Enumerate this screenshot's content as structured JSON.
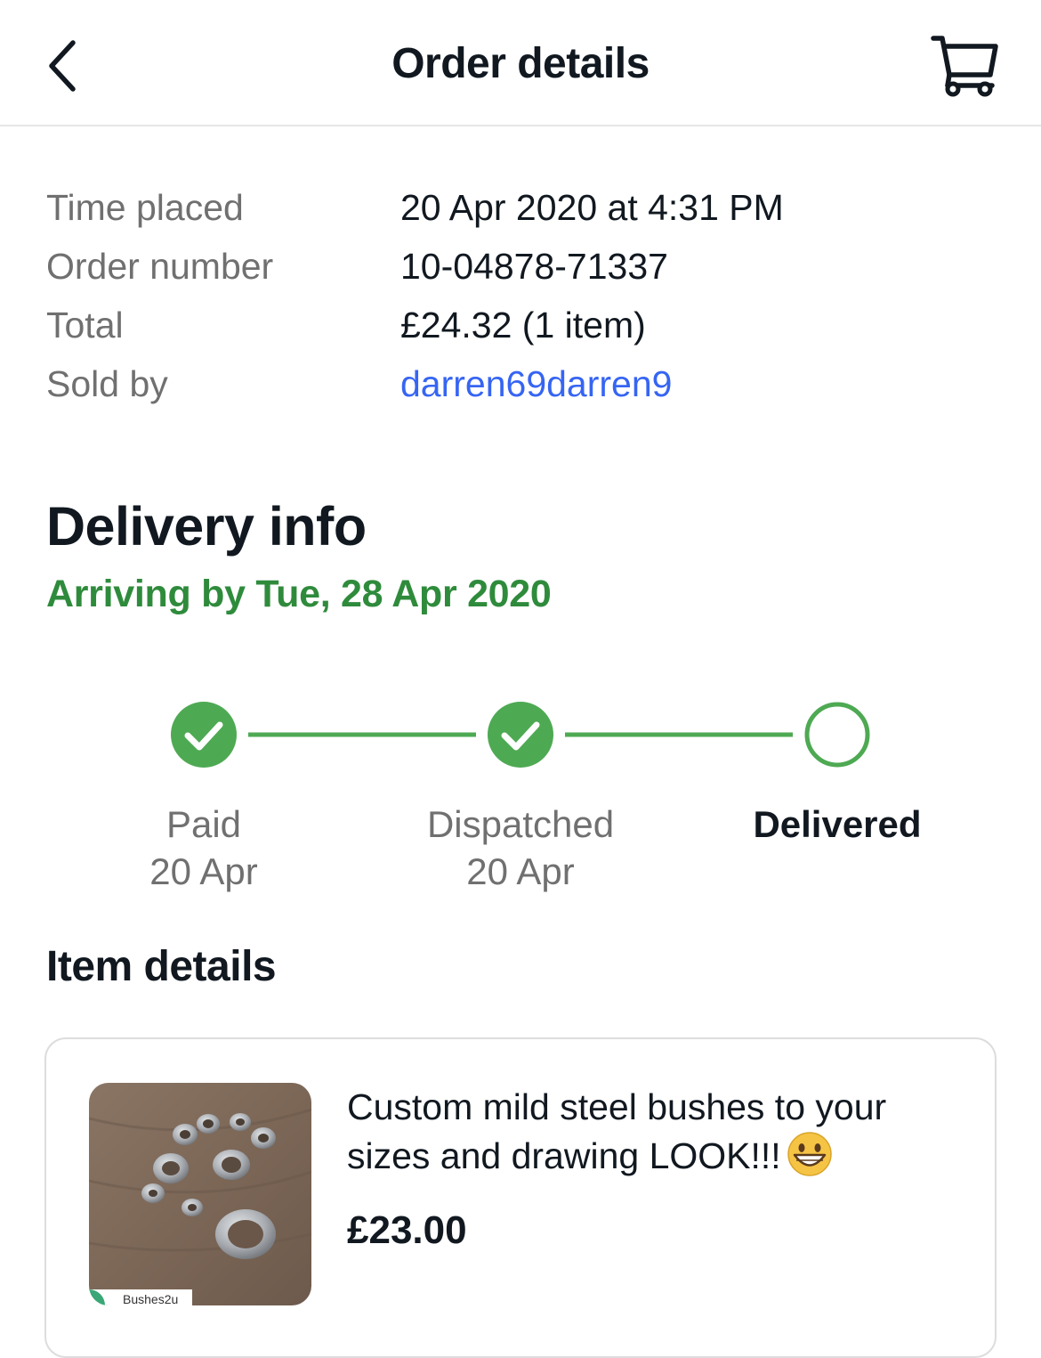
{
  "header": {
    "title": "Order details",
    "back_icon": "chevron-left-icon",
    "cart_icon": "cart-icon"
  },
  "summary": [
    {
      "label": "Time placed",
      "value": "20 Apr 2020 at 4:31 PM"
    },
    {
      "label": "Order number",
      "value": "10-04878-71337"
    },
    {
      "label": "Total",
      "value": "£24.32 (1 item)"
    },
    {
      "label": "Sold by",
      "value": "darren69darren9"
    }
  ],
  "delivery": {
    "title": "Delivery info",
    "arriving": "Arriving by Tue, 28 Apr 2020",
    "steps": [
      {
        "label": "Paid",
        "date": "20 Apr",
        "completed": true
      },
      {
        "label": "Dispatched",
        "date": "20 Apr",
        "completed": true
      },
      {
        "label": "Delivered",
        "date": "",
        "completed": false
      }
    ]
  },
  "item_details": {
    "title": "Item details",
    "item": {
      "name": "Custom mild steel bushes to your sizes and drawing LOOK!!!",
      "emoji": "grinning-face-icon",
      "price": "£23.00",
      "thumbnail_watermark": "Bushes2u"
    }
  },
  "colors": {
    "accent_green": "#2f8b3c",
    "step_green": "#4ea953",
    "link_blue": "#3665f3",
    "text_primary": "#111820",
    "text_secondary": "#707070"
  }
}
